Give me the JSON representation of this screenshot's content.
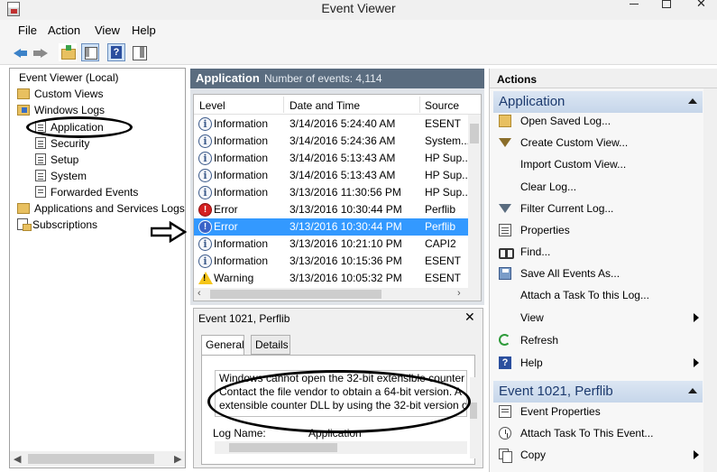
{
  "window": {
    "title": "Event Viewer",
    "close_glyph": "✕"
  },
  "menu": [
    "File",
    "Action",
    "View",
    "Help"
  ],
  "toolbar": {
    "icons": [
      "back-arrow-icon",
      "forward-arrow-icon",
      "folder-icon",
      "show-pane-icon",
      "help-icon",
      "action-pane-icon"
    ]
  },
  "tree": {
    "root": "Event Viewer (Local)",
    "custom_views": "Custom Views",
    "windows_logs": "Windows Logs",
    "application": "Application",
    "security": "Security",
    "setup": "Setup",
    "system": "System",
    "forwarded": "Forwarded Events",
    "app_services": "Applications and Services Logs",
    "subscriptions": "Subscriptions"
  },
  "center": {
    "log_name": "Application",
    "count_text": "Number of events: 4,114",
    "columns": [
      "Level",
      "Date and Time",
      "Source"
    ],
    "rows": [
      {
        "level": "Information",
        "date": "3/14/2016 5:24:40 AM",
        "source": "ESENT",
        "icon": "info"
      },
      {
        "level": "Information",
        "date": "3/14/2016 5:24:36 AM",
        "source": "System...",
        "icon": "info"
      },
      {
        "level": "Information",
        "date": "3/14/2016 5:13:43 AM",
        "source": "HP Sup...",
        "icon": "info"
      },
      {
        "level": "Information",
        "date": "3/14/2016 5:13:43 AM",
        "source": "HP Sup...",
        "icon": "info"
      },
      {
        "level": "Information",
        "date": "3/13/2016 11:30:56 PM",
        "source": "HP Sup...",
        "icon": "info"
      },
      {
        "level": "Error",
        "date": "3/13/2016 10:30:44 PM",
        "source": "Perflib",
        "icon": "error"
      },
      {
        "level": "Error",
        "date": "3/13/2016 10:30:44 PM",
        "source": "Perflib",
        "icon": "error",
        "selected": true
      },
      {
        "level": "Information",
        "date": "3/13/2016 10:21:10 PM",
        "source": "CAPI2",
        "icon": "info"
      },
      {
        "level": "Information",
        "date": "3/13/2016 10:15:36 PM",
        "source": "ESENT",
        "icon": "info"
      },
      {
        "level": "Warning",
        "date": "3/13/2016 10:05:32 PM",
        "source": "ESENT",
        "icon": "warning"
      }
    ]
  },
  "detail": {
    "title": "Event 1021, Perflib",
    "close": "✕",
    "tabs": [
      "General",
      "Details"
    ],
    "description_lines": [
      "Windows cannot open the 32-bit extensible counter",
      "Contact the file vendor to obtain a 64-bit version. A",
      "extensible counter DLL by using the 32-bit version o"
    ],
    "log_name_label": "Log Name:",
    "log_name_value": "Application"
  },
  "actions": {
    "header": "Actions",
    "section1": "Application",
    "items1": [
      {
        "label": "Open Saved Log...",
        "icon": "open-log-icon"
      },
      {
        "label": "Create Custom View...",
        "icon": "filter-icon"
      },
      {
        "label": "Import Custom View...",
        "icon": ""
      },
      {
        "label": "Clear Log...",
        "icon": ""
      },
      {
        "label": "Filter Current Log...",
        "icon": "filter-icon"
      },
      {
        "label": "Properties",
        "icon": "properties-icon"
      },
      {
        "label": "Find...",
        "icon": "find-icon"
      },
      {
        "label": "Save All Events As...",
        "icon": "save-icon"
      },
      {
        "label": "Attach a Task To this Log...",
        "icon": ""
      },
      {
        "label": "View",
        "icon": "",
        "submenu": true
      },
      {
        "label": "Refresh",
        "icon": "refresh-icon"
      },
      {
        "label": "Help",
        "icon": "help-icon",
        "submenu": true
      }
    ],
    "section2": "Event 1021, Perflib",
    "items2": [
      {
        "label": "Event Properties",
        "icon": "event-properties-icon"
      },
      {
        "label": "Attach Task To This Event...",
        "icon": "task-icon"
      },
      {
        "label": "Copy",
        "icon": "copy-icon",
        "submenu": true
      }
    ]
  }
}
